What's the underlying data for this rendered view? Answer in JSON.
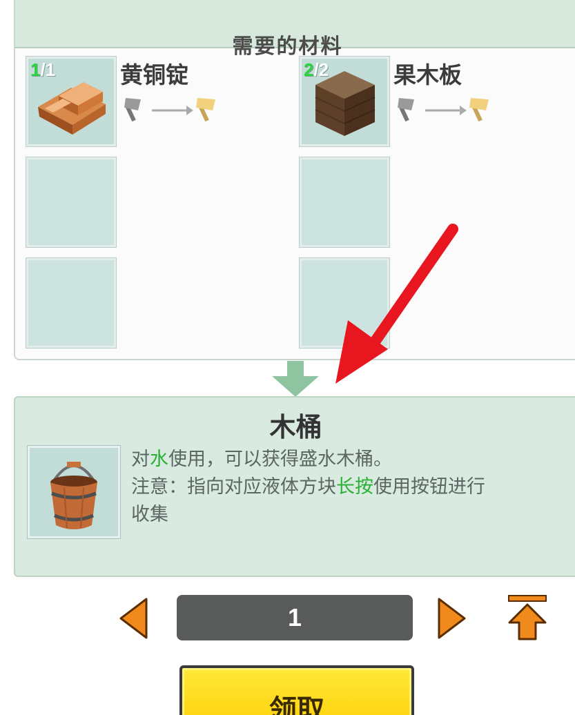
{
  "materials": {
    "header_title": "需要的材料",
    "items": [
      {
        "name": "黄铜锭",
        "have": "1",
        "need": "/1",
        "icon": "brass-ingot-icon"
      },
      {
        "name": "果木板",
        "have": "2",
        "need": "/2",
        "icon": "fruitwood-plank-icon"
      }
    ],
    "tool_icons": [
      "stone-axe-icon",
      "arrow-right-icon",
      "gold-axe-icon"
    ]
  },
  "product": {
    "name": "木桶",
    "icon": "wooden-bucket-icon",
    "desc_line1_a": "对",
    "desc_line1_hl": "水",
    "desc_line1_b": "使用，可以获得盛水木桶。",
    "desc_line2_a": "注意：指向对应液体方块",
    "desc_line2_hl": "长按",
    "desc_line2_b": "使用按钮进行",
    "desc_line3": "收集"
  },
  "controls": {
    "quantity": "1",
    "claim_label": "领取"
  },
  "colors": {
    "highlight_green": "#2ab034",
    "arrow_orange": "#f08a1c",
    "button_yellow": "#ffd600",
    "annotation_red": "#e8161e"
  }
}
